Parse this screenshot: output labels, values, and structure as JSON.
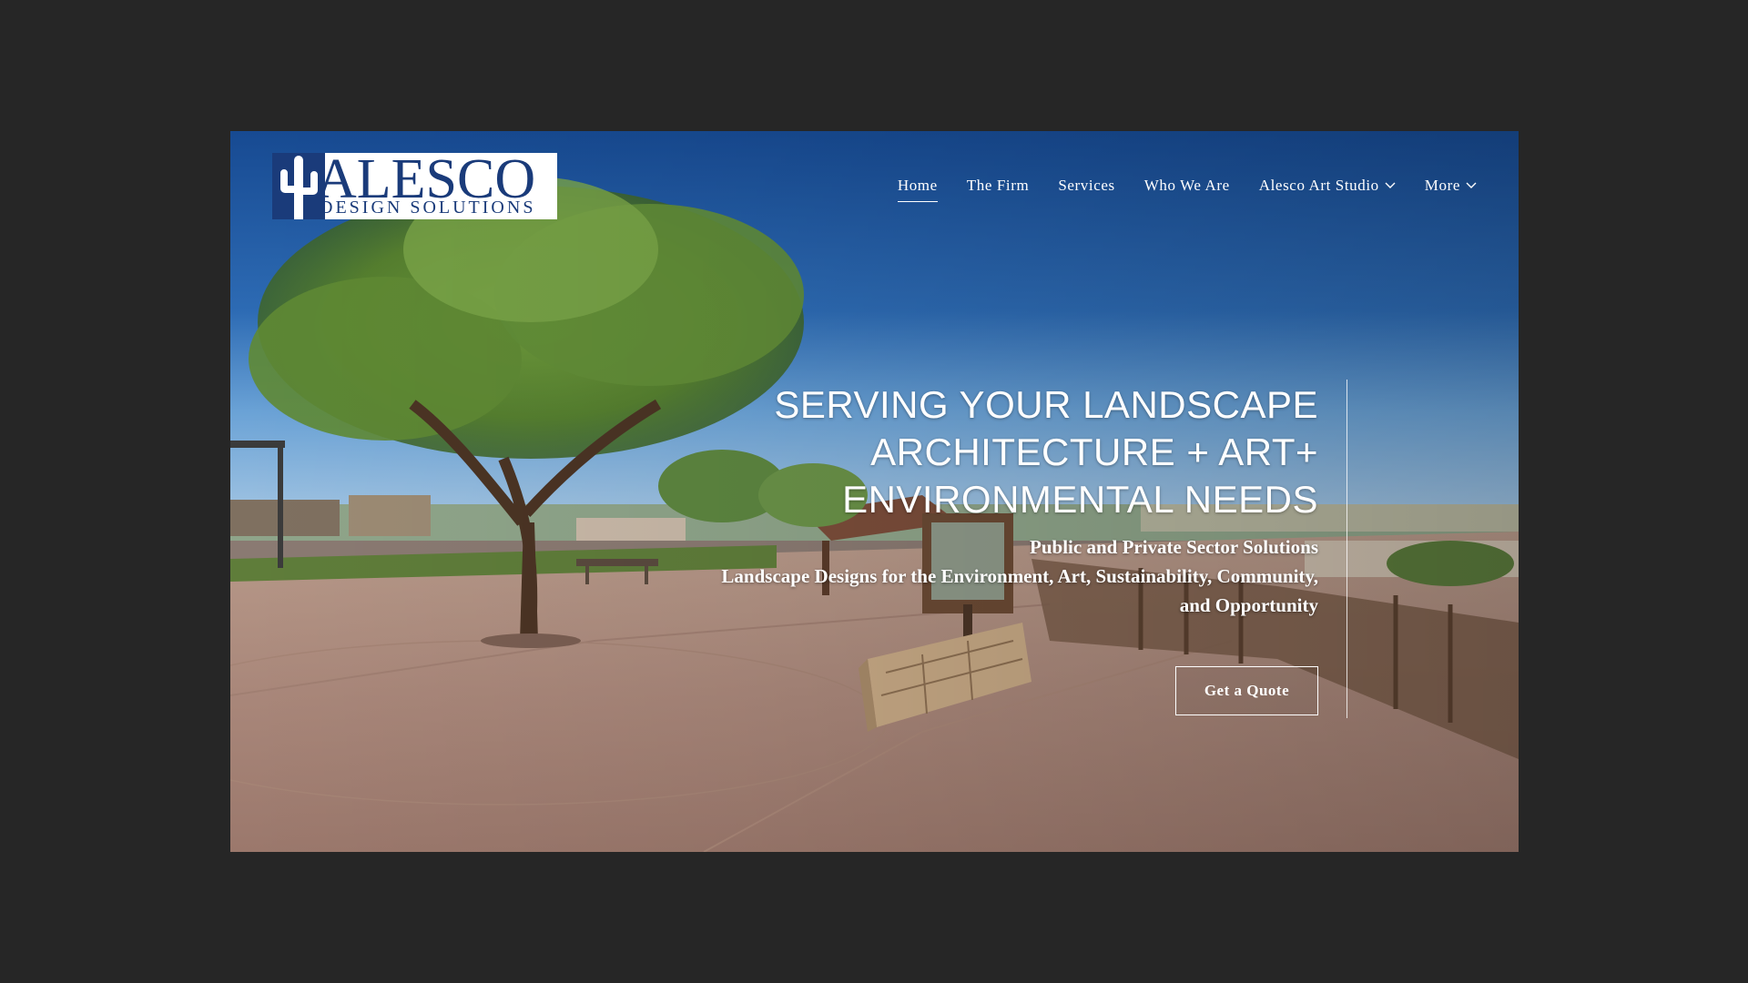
{
  "logo": {
    "main": "ALESCO",
    "sub": "DESIGN SOLUTIONS"
  },
  "nav": {
    "items": [
      {
        "label": "Home"
      },
      {
        "label": "The Firm"
      },
      {
        "label": "Services"
      },
      {
        "label": "Who We Are"
      },
      {
        "label": "Alesco Art Studio"
      },
      {
        "label": "More"
      }
    ]
  },
  "hero": {
    "title_lines": [
      "SERVING YOUR LANDSCAPE",
      "ARCHITECTURE + ART+",
      "ENVIRONMENTAL NEEDS"
    ],
    "subtitle_lines": [
      "Public and Private Sector Solutions",
      "Landscape Designs for the Environment, Art, Sustainability, Community,",
      "and Opportunity"
    ],
    "cta": "Get a Quote"
  },
  "colors": {
    "page_background": "#262626",
    "brand_blue": "#1a3b7a",
    "text_on_image": "#ffffff"
  }
}
